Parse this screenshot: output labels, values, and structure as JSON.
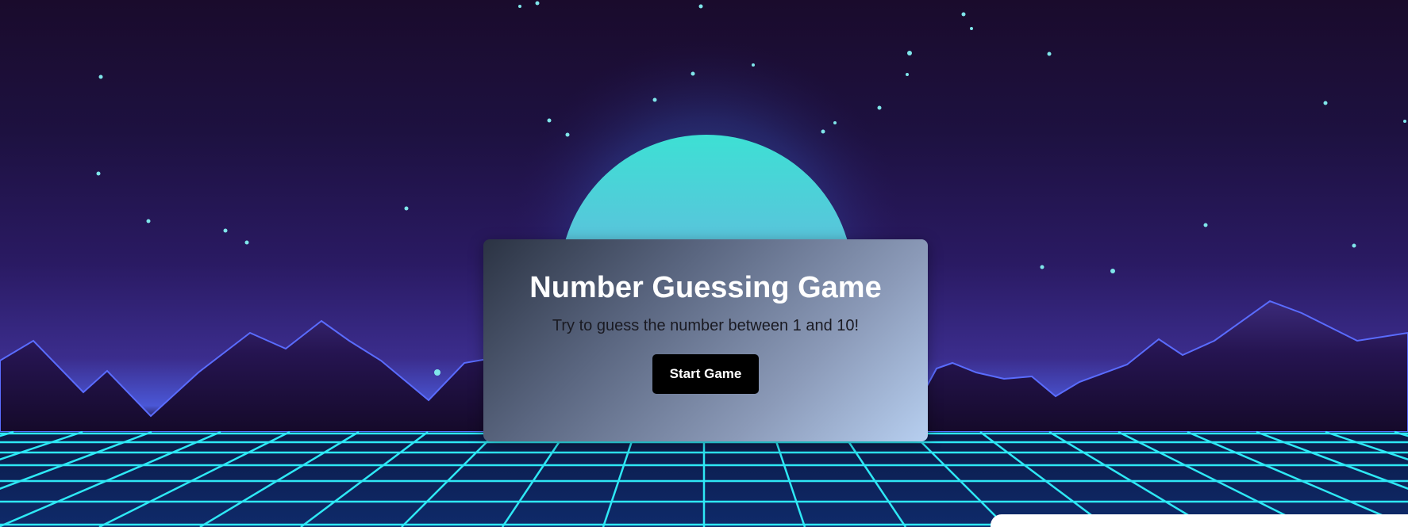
{
  "game": {
    "title": "Number Guessing Game",
    "instructions": "Try to guess the number between 1 and 10!",
    "start_button_label": "Start Game",
    "range_min": 1,
    "range_max": 10
  },
  "theme": {
    "sky_top": "#1a0b2c",
    "sky_mid": "#2a1a63",
    "sun_top": "#3de0d4",
    "sun_bottom": "#8b93e8",
    "grid_line": "#2ee8f5",
    "mountain": "#1c0e36",
    "button_bg": "#000000",
    "button_text": "#ffffff"
  },
  "icons": {
    "sun": "sun-icon",
    "stars": "star-icon"
  }
}
